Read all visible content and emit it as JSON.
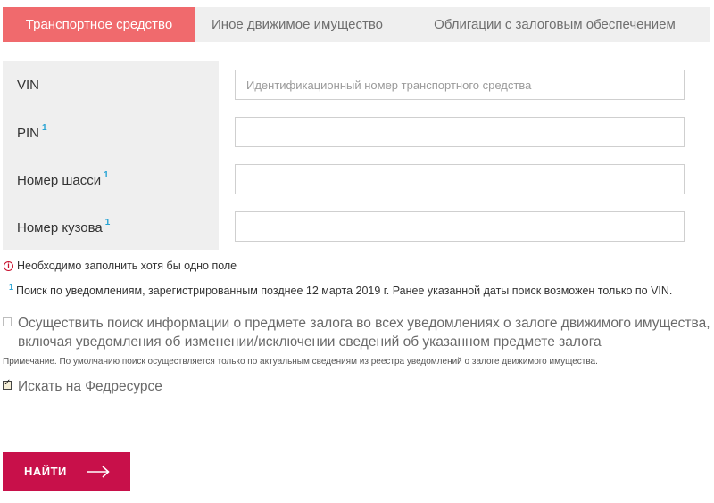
{
  "tabs": [
    {
      "label": "Транспортное средство",
      "active": true
    },
    {
      "label": "Иное движимое имущество",
      "active": false
    },
    {
      "label": "Облигации с залоговым обеспечением",
      "active": false
    }
  ],
  "form": {
    "vin": {
      "label": "VIN",
      "placeholder": "Идентификационный номер транспортного средства",
      "value": ""
    },
    "pin": {
      "label": "PIN",
      "footnote": "1",
      "value": ""
    },
    "chassis": {
      "label": "Номер шасси",
      "footnote": "1",
      "value": ""
    },
    "body": {
      "label": "Номер кузова",
      "footnote": "1",
      "value": ""
    }
  },
  "warning": {
    "text": "Необходимо заполнить хотя бы одно поле"
  },
  "footnote": {
    "mark": "1",
    "text": "Поиск по уведомлениям, зарегистрированным позднее 12 марта 2019 г. Ранее указанной даты поиск возможен только по VIN."
  },
  "options": {
    "all_notices": {
      "checked": false,
      "line1": "Осуществить поиск информации о предмете залога во всех уведомлениях о залоге движимого имущества,",
      "line2": "включая уведомления об изменении/исключении сведений об указанном предмете залога"
    },
    "note": "Примечание. По умолчанию поиск осуществляется только по актуальным сведениям из реестра уведомлений о залоге движимого имущества.",
    "fedresurs": {
      "checked": true,
      "label": "Искать на Федресурсе"
    }
  },
  "search_button": {
    "label": "НАЙТИ"
  },
  "colors": {
    "accent_tab": "#f06a6d",
    "button": "#c8104a",
    "footnote_mark": "#27a3d3",
    "warning": "#c8102e"
  }
}
